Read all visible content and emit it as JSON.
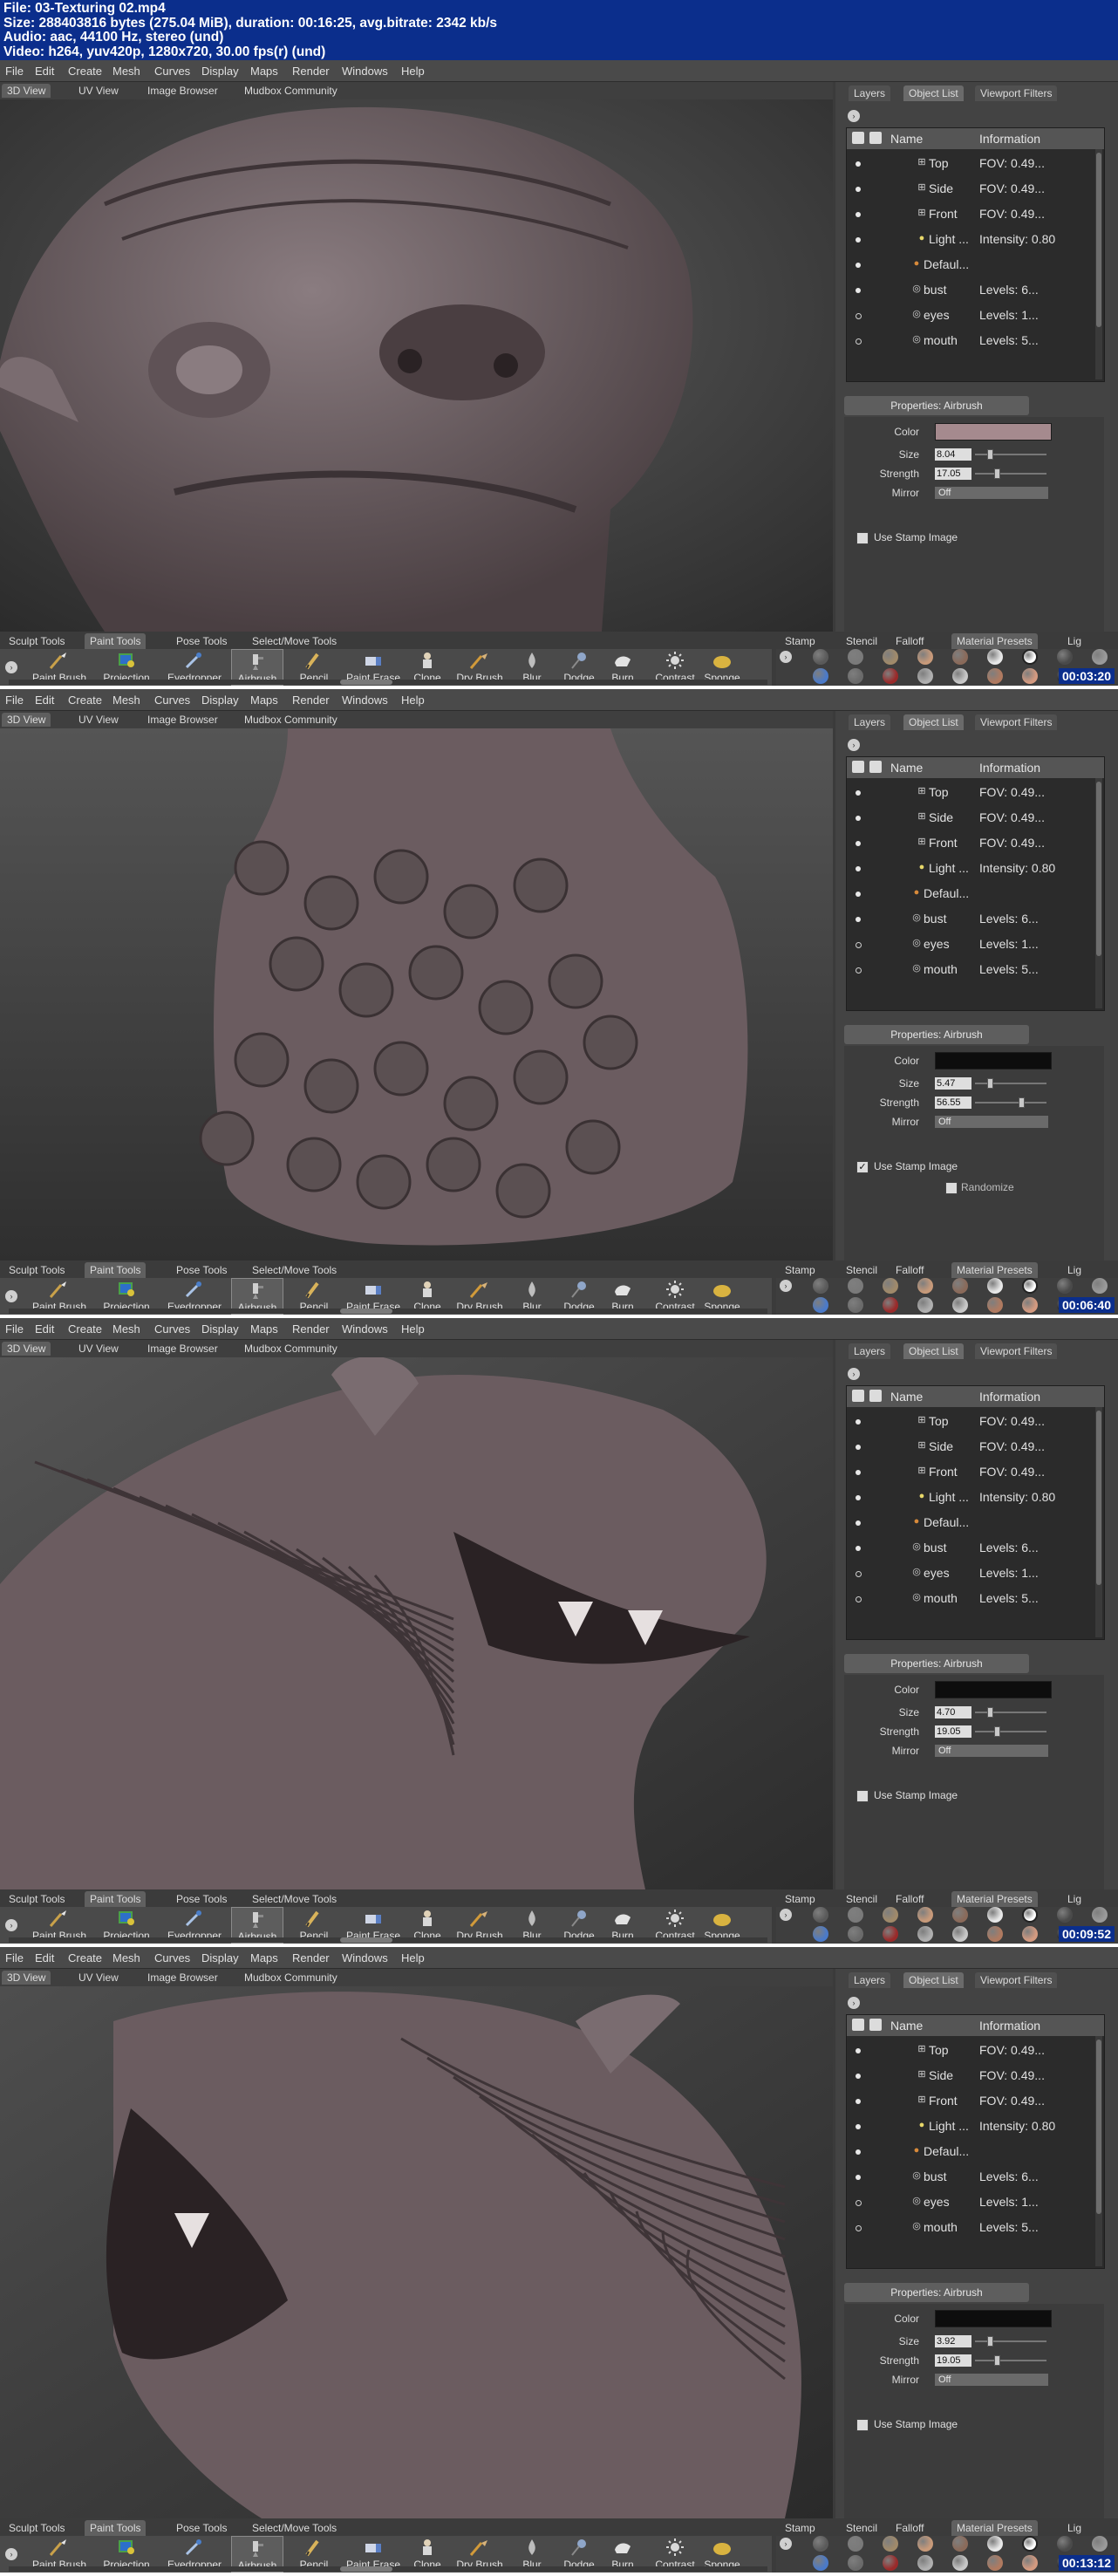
{
  "header": {
    "line1": "File: 03-Texturing 02.mp4",
    "line2": "Size: 288403816 bytes (275.04 MiB), duration: 00:16:25, avg.bitrate: 2342 kb/s",
    "line3": "Audio: aac, 44100 Hz, stereo (und)",
    "line4": "Video: h264, yuv420p, 1280x720, 30.00 fps(r) (und)"
  },
  "menu": [
    "File",
    "Edit",
    "Create",
    "Mesh",
    "Curves",
    "Display",
    "Maps",
    "Render",
    "Windows",
    "Help"
  ],
  "view_tabs": [
    "3D View",
    "UV View",
    "Image Browser",
    "Mudbox Community"
  ],
  "right_tabs": [
    "Layers",
    "Object List",
    "Viewport Filters"
  ],
  "object_list": {
    "col_name": "Name",
    "col_info": "Information",
    "rows": [
      {
        "name": "Top",
        "info": "FOV: 0.49...",
        "icon": "camera-icon",
        "visible": true
      },
      {
        "name": "Side",
        "info": "FOV: 0.49...",
        "icon": "camera-icon",
        "visible": true
      },
      {
        "name": "Front",
        "info": "FOV: 0.49...",
        "icon": "camera-icon",
        "visible": true
      },
      {
        "name": "Light ...",
        "info": "Intensity: 0.80",
        "icon": "light-icon",
        "visible": true
      },
      {
        "name": "Defaul...",
        "info": "",
        "icon": "material-icon",
        "visible": true
      },
      {
        "name": "bust",
        "info": "Levels: 6...",
        "icon": "mesh-icon",
        "visible": true
      },
      {
        "name": "eyes",
        "info": "Levels: 1...",
        "icon": "mesh-icon",
        "visible": false
      },
      {
        "name": "mouth",
        "info": "Levels: 5...",
        "icon": "mesh-icon",
        "visible": false
      }
    ]
  },
  "properties": {
    "title": "Properties: Airbrush",
    "color_label": "Color",
    "size_label": "Size",
    "strength_label": "Strength",
    "mirror_label": "Mirror",
    "mirror_value": "Off",
    "stamp_label": "Use Stamp Image",
    "randomize_label": "Randomize"
  },
  "tool_tabs": [
    "Sculpt Tools",
    "Paint Tools",
    "Pose Tools",
    "Select/Move Tools"
  ],
  "tools": [
    {
      "label": "Paint Brush",
      "icon": "paint-brush-icon"
    },
    {
      "label": "Projection",
      "icon": "projection-icon"
    },
    {
      "label": "Eyedropper",
      "icon": "eyedropper-icon"
    },
    {
      "label": "Airbrush",
      "icon": "airbrush-icon"
    },
    {
      "label": "Pencil",
      "icon": "pencil-icon"
    },
    {
      "label": "Paint Erase",
      "icon": "paint-erase-icon"
    },
    {
      "label": "Clone",
      "icon": "clone-icon"
    },
    {
      "label": "Dry Brush",
      "icon": "dry-brush-icon"
    },
    {
      "label": "Blur",
      "icon": "blur-icon"
    },
    {
      "label": "Dodge",
      "icon": "dodge-icon"
    },
    {
      "label": "Burn",
      "icon": "burn-icon"
    },
    {
      "label": "Contrast",
      "icon": "contrast-icon"
    },
    {
      "label": "Sponge",
      "icon": "sponge-icon"
    }
  ],
  "shelf_tabs": [
    "Stamp",
    "Stencil",
    "Falloff",
    "Material Presets",
    "Lig"
  ],
  "frames": [
    {
      "size": "8.04",
      "strength": "17.05",
      "color": "#a58a8e",
      "stamp_checked": false,
      "show_randomize": false,
      "timestamp": "00:03:20",
      "sculpt": "face-closeup"
    },
    {
      "size": "5.47",
      "strength": "56.55",
      "color": "#0d0d0d",
      "stamp_checked": true,
      "show_randomize": true,
      "timestamp": "00:06:40",
      "sculpt": "bumpy-back"
    },
    {
      "size": "4.70",
      "strength": "19.05",
      "color": "#0d0d0d",
      "stamp_checked": false,
      "show_randomize": false,
      "timestamp": "00:09:52",
      "sculpt": "roaring-profile"
    },
    {
      "size": "3.92",
      "strength": "19.05",
      "color": "#0d0d0d",
      "stamp_checked": false,
      "show_randomize": false,
      "timestamp": "00:13:12",
      "sculpt": "roaring-left"
    }
  ],
  "colors": {
    "header_bg": "#0b2e8c",
    "sculpt_skin": "#6b5c60",
    "panel_bg": "#434343"
  }
}
